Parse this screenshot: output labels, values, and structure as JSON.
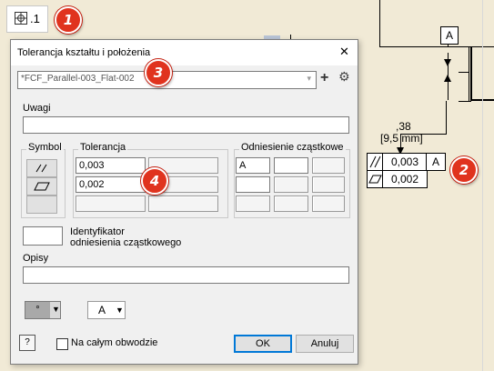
{
  "toolbar_icon": {
    "label": ".1",
    "icon": "position-tolerance-icon"
  },
  "badges": [
    "1",
    "2",
    "3",
    "4"
  ],
  "dialog": {
    "title": "Tolerancja kształtu i położenia",
    "close_symbol": "✕",
    "style_value": "*FCF_Parallel-003_Flat-002",
    "add_symbol": "+",
    "uwagi_label": "Uwagi",
    "uwagi_value": "",
    "symbol_group": "Symbol",
    "tolerance_group": "Tolerancja",
    "tolerance_values": [
      "0,003",
      "0,002"
    ],
    "datum_group": "Odniesienie cząstkowe",
    "datum_value": "A",
    "datum_identifier_label_line1": "Identyfikator",
    "datum_identifier_label_line2": "odniesienia cząstkowego",
    "opisy_label": "Opisy",
    "opisy_value": "",
    "bottom_dropdown1_value": "°",
    "bottom_dropdown2_value": "A",
    "all_around_label": "Na całym obwodzie",
    "ok_label": "OK",
    "cancel_label": "Anuluj",
    "help_label": "?"
  },
  "drawing": {
    "datum_label": "A",
    "dimension_value": ",38",
    "dimension_alt": "[9,5 mm]",
    "fcf_row1_value": "0,003",
    "fcf_row1_datum": "A",
    "fcf_row2_value": "0,002"
  }
}
